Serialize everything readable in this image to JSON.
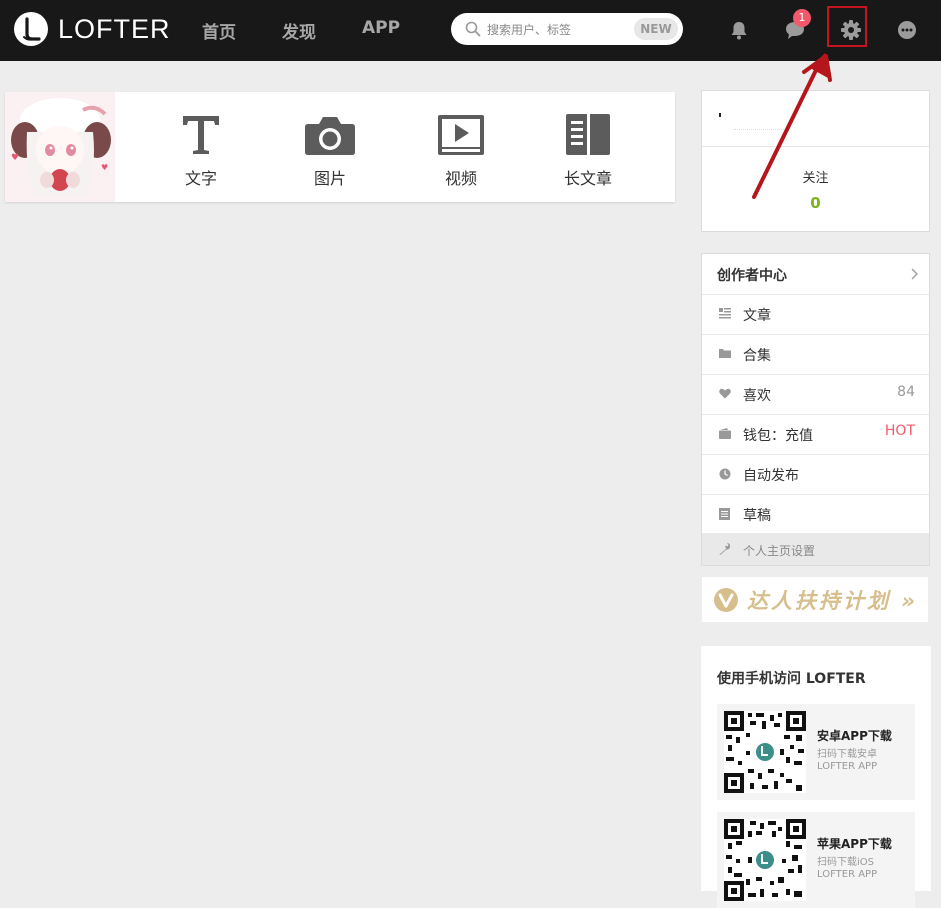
{
  "topbar": {
    "logo_text": "LOFTER",
    "nav": [
      "首页",
      "发现",
      "APP"
    ],
    "search": {
      "placeholder": "搜索用户、标签",
      "badge": "NEW"
    },
    "icons": [
      "bell-icon",
      "chat-icon",
      "gear-icon",
      "more-icon"
    ],
    "message_count": "1"
  },
  "post_types": [
    {
      "label": "文字",
      "icon": "text-icon"
    },
    {
      "label": "图片",
      "icon": "camera-icon"
    },
    {
      "label": "视频",
      "icon": "video-icon"
    },
    {
      "label": "长文章",
      "icon": "article-icon"
    }
  ],
  "user_card": {
    "follow_label": "关注",
    "follow_count": "0"
  },
  "menu": {
    "header": "创作者中心",
    "items": [
      {
        "label": "文章",
        "icon": "list-icon",
        "value": ""
      },
      {
        "label": "合集",
        "icon": "folder-icon",
        "value": ""
      },
      {
        "label": "喜欢",
        "icon": "heart-icon",
        "value": "84"
      },
      {
        "label": "钱包：充值",
        "icon": "wallet-icon",
        "value": "HOT"
      },
      {
        "label": "自动发布",
        "icon": "clock-icon",
        "value": ""
      },
      {
        "label": "草稿",
        "icon": "draft-icon",
        "value": ""
      }
    ],
    "settings": "个人主页设置",
    "hot_color": "#f2596a"
  },
  "banner": {
    "text": "达人扶持计划 »"
  },
  "app_panel": {
    "title": "使用手机访问 LOFTER",
    "cards": [
      {
        "title": "安卓APP下载",
        "line1": "扫码下载安卓",
        "line2": "LOFTER APP"
      },
      {
        "title": "苹果APP下载",
        "line1": "扫码下载iOS",
        "line2": "LOFTER APP"
      }
    ]
  },
  "colors": {
    "topbar": "#181818",
    "follow_count": "#7bb31a",
    "annotation": "#c4151c",
    "banner": "#d6be8d"
  }
}
